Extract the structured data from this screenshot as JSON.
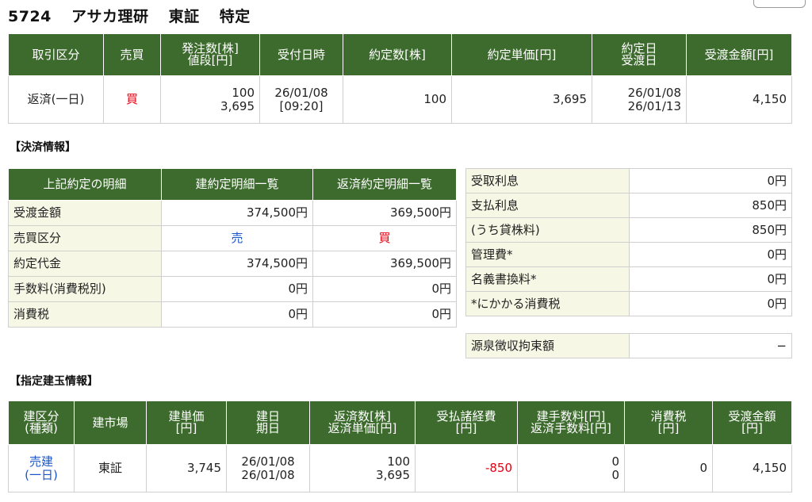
{
  "header": {
    "code": "5724",
    "name": "アサカ理研",
    "market": "東証",
    "account": "特定"
  },
  "trade": {
    "headers": [
      "取引区分",
      "売買",
      "発注数[株]",
      "値段[円]",
      "受付日時",
      "約定数[株]",
      "約定単価[円]",
      "約定日",
      "受渡日",
      "受渡金額[円]"
    ],
    "row": {
      "kubun": "返済(一日)",
      "side": "買",
      "qty": "100",
      "price": "3,695",
      "date": "26/01/08",
      "time": "[09:20]",
      "exec_qty": "100",
      "exec_price": "3,695",
      "exec_date": "26/01/08",
      "settle_date": "26/01/13",
      "amount": "4,150"
    }
  },
  "settlement": {
    "title": "【決済情報】",
    "headers": [
      "上記約定の明細",
      "建約定明細一覧",
      "返済約定明細一覧"
    ],
    "rows": [
      {
        "label": "受渡金額",
        "open": "374,500円",
        "close": "369,500円"
      },
      {
        "label": "売買区分",
        "open": "売",
        "close": "買"
      },
      {
        "label": "約定代金",
        "open": "374,500円",
        "close": "369,500円"
      },
      {
        "label": "手数料(消費税別)",
        "open": "0円",
        "close": "0円"
      },
      {
        "label": "消費税",
        "open": "0円",
        "close": "0円"
      }
    ],
    "side_rows": [
      {
        "label": "受取利息",
        "value": "0円"
      },
      {
        "label": "支払利息",
        "value": "850円"
      },
      {
        "label": "(うち貸株料)",
        "value": "850円"
      },
      {
        "label": "管理費*",
        "value": "0円"
      },
      {
        "label": "名義書換料*",
        "value": "0円"
      },
      {
        "label": "*にかかる消費税",
        "value": "0円"
      }
    ],
    "withholding": {
      "label": "源泉徴収拘束額",
      "value": "−"
    }
  },
  "positions": {
    "title": "【指定建玉情報】",
    "headers": [
      "建区分",
      "(種類)",
      "建市場",
      "建単価",
      "[円]",
      "建日",
      "期日",
      "返済数[株]",
      "返済単価[円]",
      "受払諸経費",
      "[円]",
      "建手数料[円]",
      "返済手数料[円]",
      "消費税",
      "[円]",
      "受渡金額",
      "[円]"
    ],
    "row": {
      "type": "売建",
      "subtype": "(一日)",
      "market": "東証",
      "price": "3,745",
      "open_date": "26/01/08",
      "due_date": "26/01/08",
      "qty": "100",
      "repay_price": "3,695",
      "expenses": "-850",
      "open_fee": "0",
      "close_fee": "0",
      "tax": "0",
      "amount": "4,150"
    }
  }
}
